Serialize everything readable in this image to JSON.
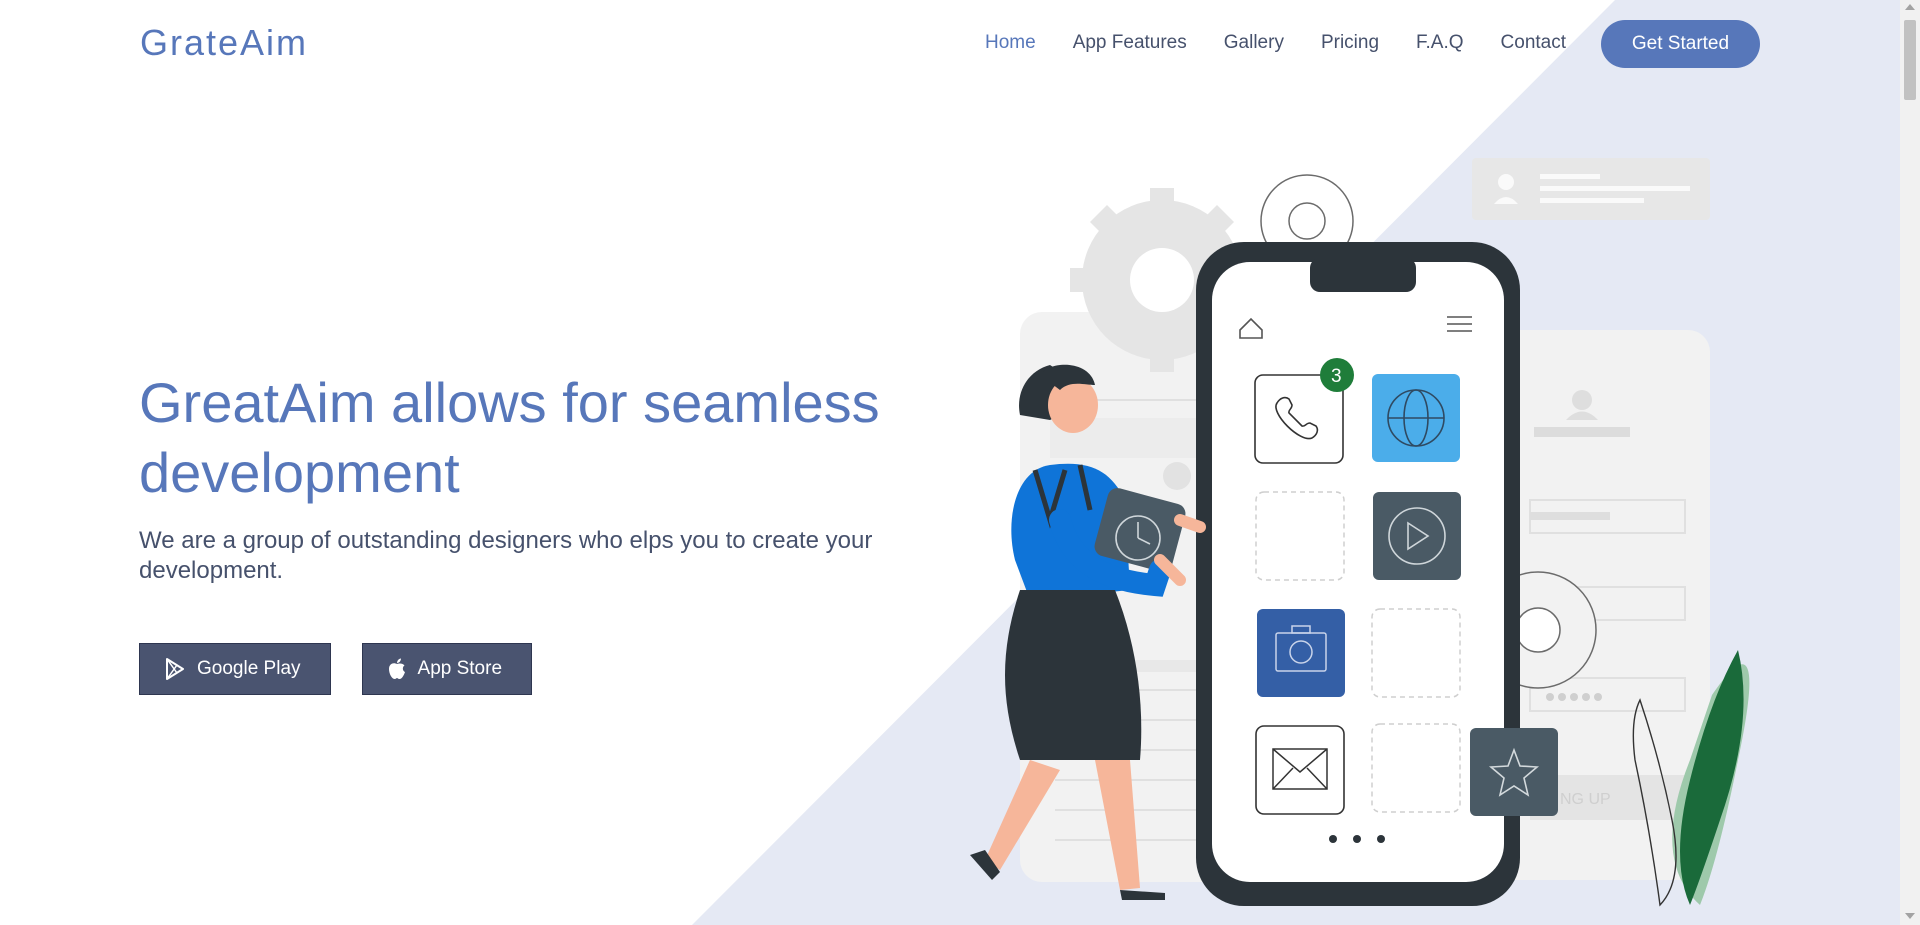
{
  "brand": {
    "logo": "GrateAim",
    "accent": "#5777ba",
    "bg_tint": "#e5e9f4"
  },
  "nav": {
    "items": [
      {
        "label": "Home",
        "active": true
      },
      {
        "label": "App Features",
        "active": false
      },
      {
        "label": "Gallery",
        "active": false
      },
      {
        "label": "Pricing",
        "active": false
      },
      {
        "label": "F.A.Q",
        "active": false
      },
      {
        "label": "Contact",
        "active": false
      }
    ],
    "cta": "Get Started"
  },
  "hero": {
    "title": "GreatAim allows for seamless development",
    "subtitle": "We are a group of outstanding designers who elps you to create your development.",
    "buttons": [
      {
        "label": "Google Play",
        "icon": "google-play-icon"
      },
      {
        "label": "App Store",
        "icon": "apple-icon"
      }
    ]
  },
  "illustration": {
    "badge_count": "3",
    "signup_text": "NG UP",
    "app_icons": [
      "phone-icon",
      "globe-icon",
      "play-icon",
      "camera-icon",
      "mail-icon",
      "star-icon"
    ]
  }
}
